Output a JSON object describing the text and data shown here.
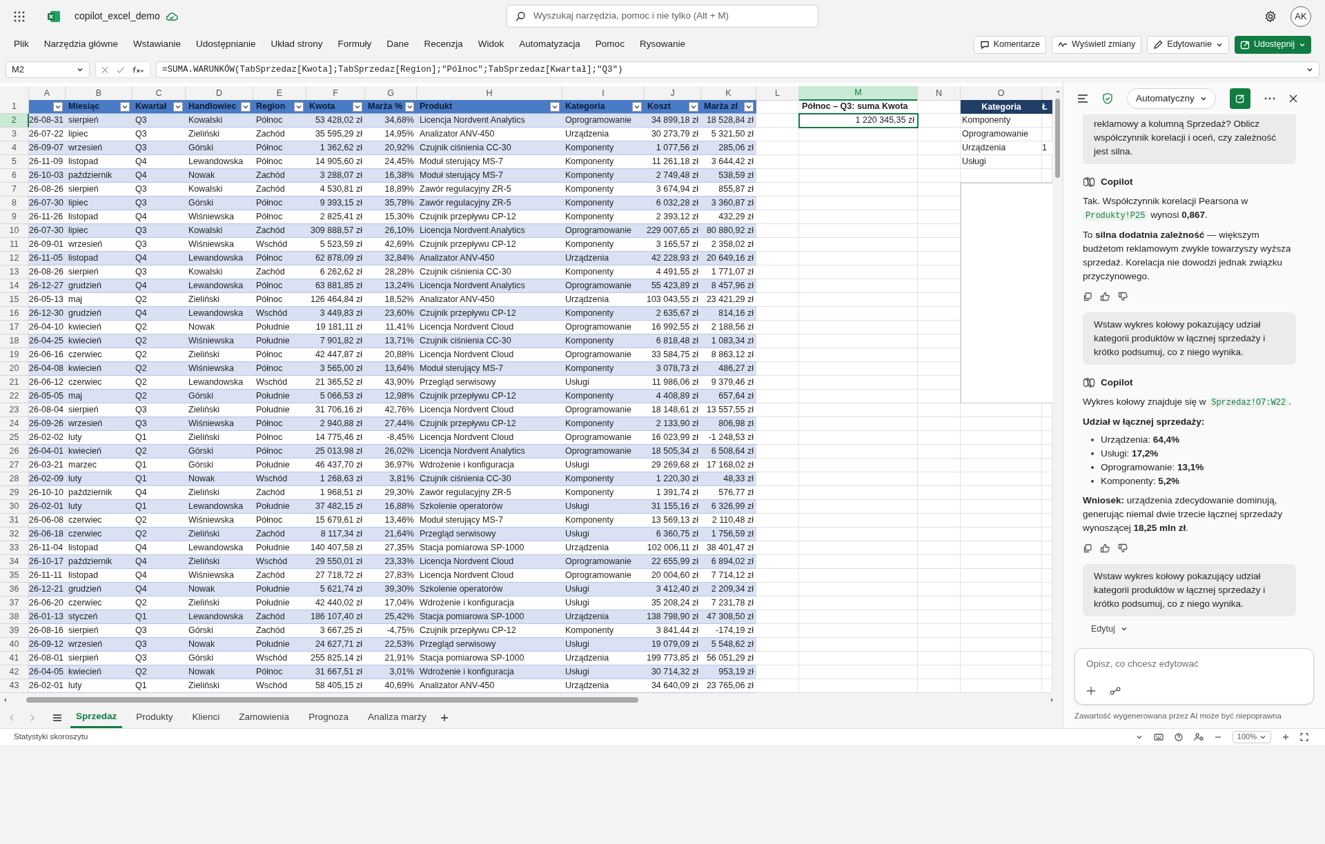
{
  "title_bar": {
    "file_name": "copilot_excel_demo",
    "search_placeholder": "Wyszukaj narzędzia, pomoc i nie tylko (Alt + M)",
    "avatar": "AK"
  },
  "menu": [
    "Plik",
    "Narzędzia główne",
    "Wstawianie",
    "Udostępnianie",
    "Układ strony",
    "Formuły",
    "Dane",
    "Recenzja",
    "Widok",
    "Automatyzacja",
    "Pomoc",
    "Rysowanie"
  ],
  "toolbar_buttons": [
    {
      "kind": "comments",
      "label": "Komentarze"
    },
    {
      "kind": "changes",
      "label": "Wyświetl zmiany"
    },
    {
      "kind": "editing",
      "label": "Edytowanie"
    },
    {
      "kind": "share",
      "label": "Udostępnij"
    }
  ],
  "formula_bar": {
    "name_box": "M2",
    "formula": "=SUMA.WARUNKÓW(TabSprzedaz[Kwota];TabSprzedaz[Region];\"Północ\";TabSprzedaz[Kwartał];\"Q3\")"
  },
  "columns": [
    {
      "letter": "A",
      "selected": false
    },
    {
      "letter": "B",
      "selected": false
    },
    {
      "letter": "C",
      "selected": false
    },
    {
      "letter": "D",
      "selected": false
    },
    {
      "letter": "E",
      "selected": false
    },
    {
      "letter": "F",
      "selected": false
    },
    {
      "letter": "G",
      "selected": false
    },
    {
      "letter": "H",
      "selected": false
    },
    {
      "letter": "I",
      "selected": false
    },
    {
      "letter": "J",
      "selected": false
    },
    {
      "letter": "K",
      "selected": false
    },
    {
      "letter": "L",
      "selected": false
    },
    {
      "letter": "M",
      "selected": true
    },
    {
      "letter": "N",
      "selected": false
    },
    {
      "letter": "O",
      "selected": false
    }
  ],
  "table": {
    "header_row_number": "1",
    "headers": [
      {
        "filter": true
      },
      {
        "label": "Miesiąc",
        "filter": true
      },
      {
        "label": "Kwartał",
        "filter": true
      },
      {
        "label": "Handlowiec",
        "filter": true
      },
      {
        "label": "Region",
        "filter": true
      },
      {
        "label": "Kwota",
        "filter": true
      },
      {
        "label": "Marża %",
        "filter": true
      },
      {
        "label": "Produkt",
        "filter": true
      },
      {
        "label": "Kategoria",
        "filter": true
      },
      {
        "label": "Koszt",
        "filter": true
      },
      {
        "label": "Marża zł",
        "filter": true
      }
    ],
    "rows": [
      {
        "number": "2",
        "selected": true,
        "cells": [
          "26-08-31",
          "sierpień",
          "Q3",
          "Kowalski",
          "Północ",
          "53 428,02 zł",
          "34,68%",
          "Licencja Nordvent Analytics",
          "Oprogramowanie",
          "34 899,18 zł",
          "18 528,84 zł"
        ]
      },
      {
        "number": "3",
        "selected": false,
        "cells": [
          "26-07-22",
          "lipiec",
          "Q3",
          "Zieliński",
          "Zachód",
          "35 595,29 zł",
          "14,95%",
          "Analizator ANV-450",
          "Urządzenia",
          "30 273,79 zł",
          "5 321,50 zł"
        ]
      },
      {
        "number": "4",
        "selected": false,
        "cells": [
          "26-09-07",
          "wrzesień",
          "Q3",
          "Górski",
          "Północ",
          "1 362,62 zł",
          "20,92%",
          "Czujnik ciśnienia CC-30",
          "Komponenty",
          "1 077,56 zł",
          "285,06 zł"
        ]
      },
      {
        "number": "5",
        "selected": false,
        "cells": [
          "26-11-09",
          "listopad",
          "Q4",
          "Lewandowska",
          "Północ",
          "14 905,60 zł",
          "24,45%",
          "Moduł sterujący MS-7",
          "Komponenty",
          "11 261,18 zł",
          "3 644,42 zł"
        ]
      },
      {
        "number": "6",
        "selected": false,
        "cells": [
          "26-10-03",
          "październik",
          "Q4",
          "Nowak",
          "Zachód",
          "3 288,07 zł",
          "16,38%",
          "Moduł sterujący MS-7",
          "Komponenty",
          "2 749,48 zł",
          "538,59 zł"
        ]
      },
      {
        "number": "7",
        "selected": false,
        "cells": [
          "26-08-26",
          "sierpień",
          "Q3",
          "Kowalski",
          "Zachód",
          "4 530,81 zł",
          "18,89%",
          "Zawór regulacyjny ZR-5",
          "Komponenty",
          "3 674,94 zł",
          "855,87 zł"
        ]
      },
      {
        "number": "8",
        "selected": false,
        "cells": [
          "26-07-30",
          "lipiec",
          "Q3",
          "Górski",
          "Północ",
          "9 393,15 zł",
          "35,78%",
          "Zawór regulacyjny ZR-5",
          "Komponenty",
          "6 032,28 zł",
          "3 360,87 zł"
        ]
      },
      {
        "number": "9",
        "selected": false,
        "cells": [
          "26-11-26",
          "listopad",
          "Q4",
          "Wiśniewska",
          "Północ",
          "2 825,41 zł",
          "15,30%",
          "Czujnik przepływu CP-12",
          "Komponenty",
          "2 393,12 zł",
          "432,29 zł"
        ]
      },
      {
        "number": "10",
        "selected": false,
        "cells": [
          "26-07-30",
          "lipiec",
          "Q3",
          "Kowalski",
          "Zachód",
          "309 888,57 zł",
          "26,10%",
          "Licencja Nordvent Analytics",
          "Oprogramowanie",
          "229 007,65 zł",
          "80 880,92 zł"
        ]
      },
      {
        "number": "11",
        "selected": false,
        "cells": [
          "26-09-01",
          "wrzesień",
          "Q3",
          "Wiśniewska",
          "Wschód",
          "5 523,59 zł",
          "42,69%",
          "Czujnik przepływu CP-12",
          "Komponenty",
          "3 165,57 zł",
          "2 358,02 zł"
        ]
      },
      {
        "number": "12",
        "selected": false,
        "cells": [
          "26-11-05",
          "listopad",
          "Q4",
          "Lewandowska",
          "Północ",
          "62 878,09 zł",
          "32,84%",
          "Analizator ANV-450",
          "Urządzenia",
          "42 228,93 zł",
          "20 649,16 zł"
        ]
      },
      {
        "number": "13",
        "selected": false,
        "cells": [
          "26-08-26",
          "sierpień",
          "Q3",
          "Kowalski",
          "Zachód",
          "6 262,62 zł",
          "28,28%",
          "Czujnik ciśnienia CC-30",
          "Komponenty",
          "4 491,55 zł",
          "1 771,07 zł"
        ]
      },
      {
        "number": "14",
        "selected": false,
        "cells": [
          "26-12-27",
          "grudzień",
          "Q4",
          "Lewandowska",
          "Północ",
          "63 881,85 zł",
          "13,24%",
          "Licencja Nordvent Analytics",
          "Oprogramowanie",
          "55 423,89 zł",
          "8 457,96 zł"
        ]
      },
      {
        "number": "15",
        "selected": false,
        "cells": [
          "26-05-13",
          "maj",
          "Q2",
          "Zieliński",
          "Północ",
          "126 464,84 zł",
          "18,52%",
          "Analizator ANV-450",
          "Urządzenia",
          "103 043,55 zł",
          "23 421,29 zł"
        ]
      },
      {
        "number": "16",
        "selected": false,
        "cells": [
          "26-12-30",
          "grudzień",
          "Q4",
          "Lewandowska",
          "Wschód",
          "3 449,83 zł",
          "23,60%",
          "Czujnik przepływu CP-12",
          "Komponenty",
          "2 635,67 zł",
          "814,16 zł"
        ]
      },
      {
        "number": "17",
        "selected": false,
        "cells": [
          "26-04-10",
          "kwiecień",
          "Q2",
          "Nowak",
          "Południe",
          "19 181,11 zł",
          "11,41%",
          "Licencja Nordvent Cloud",
          "Oprogramowanie",
          "16 992,55 zł",
          "2 188,56 zł"
        ]
      },
      {
        "number": "18",
        "selected": false,
        "cells": [
          "26-04-25",
          "kwiecień",
          "Q2",
          "Wiśniewska",
          "Południe",
          "7 901,82 zł",
          "13,71%",
          "Czujnik ciśnienia CC-30",
          "Komponenty",
          "6 818,48 zł",
          "1 083,34 zł"
        ]
      },
      {
        "number": "19",
        "selected": false,
        "cells": [
          "26-06-16",
          "czerwiec",
          "Q2",
          "Zieliński",
          "Północ",
          "42 447,87 zł",
          "20,88%",
          "Licencja Nordvent Cloud",
          "Oprogramowanie",
          "33 584,75 zł",
          "8 863,12 zł"
        ]
      },
      {
        "number": "20",
        "selected": false,
        "cells": [
          "26-04-08",
          "kwiecień",
          "Q2",
          "Wiśniewska",
          "Północ",
          "3 565,00 zł",
          "13,64%",
          "Moduł sterujący MS-7",
          "Komponenty",
          "3 078,73 zł",
          "486,27 zł"
        ]
      },
      {
        "number": "21",
        "selected": false,
        "cells": [
          "26-06-12",
          "czerwiec",
          "Q2",
          "Lewandowska",
          "Wschód",
          "21 365,52 zł",
          "43,90%",
          "Przegląd serwisowy",
          "Usługi",
          "11 986,06 zł",
          "9 379,46 zł"
        ]
      },
      {
        "number": "22",
        "selected": false,
        "cells": [
          "26-05-05",
          "maj",
          "Q2",
          "Górski",
          "Południe",
          "5 066,53 zł",
          "12,98%",
          "Czujnik przepływu CP-12",
          "Komponenty",
          "4 408,89 zł",
          "657,64 zł"
        ]
      },
      {
        "number": "23",
        "selected": false,
        "cells": [
          "26-08-04",
          "sierpień",
          "Q3",
          "Zieliński",
          "Południe",
          "31 706,16 zł",
          "42,76%",
          "Licencja Nordvent Cloud",
          "Oprogramowanie",
          "18 148,61 zł",
          "13 557,55 zł"
        ]
      },
      {
        "number": "24",
        "selected": false,
        "cells": [
          "26-09-26",
          "wrzesień",
          "Q3",
          "Wiśniewska",
          "Północ",
          "2 940,88 zł",
          "27,44%",
          "Czujnik przepływu CP-12",
          "Komponenty",
          "2 133,90 zł",
          "806,98 zł"
        ]
      },
      {
        "number": "25",
        "selected": false,
        "cells": [
          "26-02-02",
          "luty",
          "Q1",
          "Zieliński",
          "Północ",
          "14 775,46 zł",
          "-8,45%",
          "Licencja Nordvent Cloud",
          "Oprogramowanie",
          "16 023,99 zł",
          "-1 248,53 zł"
        ]
      },
      {
        "number": "26",
        "selected": false,
        "cells": [
          "26-04-01",
          "kwiecień",
          "Q2",
          "Górski",
          "Północ",
          "25 013,98 zł",
          "26,02%",
          "Licencja Nordvent Analytics",
          "Oprogramowanie",
          "18 505,34 zł",
          "6 508,64 zł"
        ]
      },
      {
        "number": "27",
        "selected": false,
        "cells": [
          "26-03-21",
          "marzec",
          "Q1",
          "Górski",
          "Południe",
          "46 437,70 zł",
          "36,97%",
          "Wdrożenie i konfiguracja",
          "Usługi",
          "29 269,68 zł",
          "17 168,02 zł"
        ]
      },
      {
        "number": "28",
        "selected": false,
        "cells": [
          "26-02-09",
          "luty",
          "Q1",
          "Nowak",
          "Wschód",
          "1 268,63 zł",
          "3,81%",
          "Czujnik ciśnienia CC-30",
          "Komponenty",
          "1 220,30 zł",
          "48,33 zł"
        ]
      },
      {
        "number": "29",
        "selected": false,
        "cells": [
          "26-10-10",
          "październik",
          "Q4",
          "Zieliński",
          "Zachód",
          "1 968,51 zł",
          "29,30%",
          "Zawór regulacyjny ZR-5",
          "Komponenty",
          "1 391,74 zł",
          "576,77 zł"
        ]
      },
      {
        "number": "30",
        "selected": false,
        "cells": [
          "26-02-01",
          "luty",
          "Q1",
          "Lewandowska",
          "Południe",
          "37 482,15 zł",
          "16,88%",
          "Szkolenie operatorów",
          "Usługi",
          "31 155,16 zł",
          "6 326,99 zł"
        ]
      },
      {
        "number": "31",
        "selected": false,
        "cells": [
          "26-06-08",
          "czerwiec",
          "Q2",
          "Wiśniewska",
          "Północ",
          "15 679,61 zł",
          "13,46%",
          "Moduł sterujący MS-7",
          "Komponenty",
          "13 569,13 zł",
          "2 110,48 zł"
        ]
      },
      {
        "number": "32",
        "selected": false,
        "cells": [
          "26-06-18",
          "czerwiec",
          "Q2",
          "Zieliński",
          "Zachód",
          "8 117,34 zł",
          "21,64%",
          "Przegląd serwisowy",
          "Usługi",
          "6 360,75 zł",
          "1 756,59 zł"
        ]
      },
      {
        "number": "33",
        "selected": false,
        "cells": [
          "26-11-04",
          "listopad",
          "Q4",
          "Lewandowska",
          "Południe",
          "140 407,58 zł",
          "27,35%",
          "Stacja pomiarowa SP-1000",
          "Urządzenia",
          "102 006,11 zł",
          "38 401,47 zł"
        ]
      },
      {
        "number": "34",
        "selected": false,
        "cells": [
          "26-10-17",
          "październik",
          "Q4",
          "Zieliński",
          "Wschód",
          "29 550,01 zł",
          "23,33%",
          "Licencja Nordvent Cloud",
          "Oprogramowanie",
          "22 655,99 zł",
          "6 894,02 zł"
        ]
      },
      {
        "number": "35",
        "selected": false,
        "cells": [
          "26-11-11",
          "listopad",
          "Q4",
          "Wiśniewska",
          "Zachód",
          "27 718,72 zł",
          "27,83%",
          "Licencja Nordvent Cloud",
          "Oprogramowanie",
          "20 004,60 zł",
          "7 714,12 zł"
        ]
      },
      {
        "number": "36",
        "selected": false,
        "cells": [
          "26-12-21",
          "grudzień",
          "Q4",
          "Nowak",
          "Południe",
          "5 621,74 zł",
          "39,30%",
          "Szkolenie operatorów",
          "Usługi",
          "3 412,40 zł",
          "2 209,34 zł"
        ]
      },
      {
        "number": "37",
        "selected": false,
        "cells": [
          "26-06-20",
          "czerwiec",
          "Q2",
          "Zieliński",
          "Południe",
          "42 440,02 zł",
          "17,04%",
          "Wdrożenie i konfiguracja",
          "Usługi",
          "35 208,24 zł",
          "7 231,78 zł"
        ]
      },
      {
        "number": "38",
        "selected": false,
        "cells": [
          "26-01-13",
          "styczeń",
          "Q1",
          "Lewandowska",
          "Zachód",
          "186 107,40 zł",
          "25,42%",
          "Stacja pomiarowa SP-1000",
          "Urządzenia",
          "138 798,90 zł",
          "47 308,50 zł"
        ]
      },
      {
        "number": "39",
        "selected": false,
        "cells": [
          "26-08-16",
          "sierpień",
          "Q3",
          "Górski",
          "Zachód",
          "3 667,25 zł",
          "-4,75%",
          "Czujnik przepływu CP-12",
          "Komponenty",
          "3 841,44 zł",
          "-174,19 zł"
        ]
      },
      {
        "number": "40",
        "selected": false,
        "cells": [
          "26-09-12",
          "wrzesień",
          "Q3",
          "Nowak",
          "Południe",
          "24 627,71 zł",
          "22,53%",
          "Przegląd serwisowy",
          "Usługi",
          "19 079,09 zł",
          "5 548,62 zł"
        ]
      },
      {
        "number": "41",
        "selected": false,
        "cells": [
          "26-08-01",
          "sierpień",
          "Q3",
          "Górski",
          "Wschód",
          "255 825,14 zł",
          "21,91%",
          "Stacja pomiarowa SP-1000",
          "Urządzenia",
          "199 773,85 zł",
          "56 051,29 zł"
        ]
      },
      {
        "number": "42",
        "selected": false,
        "cells": [
          "26-04-05",
          "kwiecień",
          "Q2",
          "Nowak",
          "Północ",
          "31 667,51 zł",
          "3,01%",
          "Wdrożenie i konfiguracja",
          "Usługi",
          "30 714,32 zł",
          "953,19 zł"
        ]
      },
      {
        "number": "43",
        "selected": false,
        "cells": [
          "26-02-01",
          "luty",
          "Q1",
          "Zieliński",
          "Wschód",
          "58 405,15 zł",
          "40,69%",
          "Analizator ANV-450",
          "Urządzenia",
          "34 640,09 zł",
          "23 765,06 zł"
        ]
      }
    ]
  },
  "summary": {
    "label": "Północ – Q3: suma Kwota",
    "value": "1 220 345,35 zł"
  },
  "category_table": {
    "header": "Kategoria",
    "header_cut": "Ł",
    "items": [
      {
        "label": "Komponenty"
      },
      {
        "label": "Oprogramowanie"
      },
      {
        "label": "Urządzenia",
        "column_p": "1"
      },
      {
        "label": "Usługi"
      }
    ]
  },
  "sheet_tabs": [
    {
      "label": "Sprzedaz",
      "selected": true
    },
    {
      "label": "Produkty",
      "selected": false
    },
    {
      "label": "Klienci",
      "selected": false
    },
    {
      "label": "Zamowienia",
      "selected": false
    },
    {
      "label": "Prognoza",
      "selected": false
    },
    {
      "label": "Analiza marży",
      "selected": false
    }
  ],
  "status_bar": {
    "text": "Statystyki skoroszytu",
    "zoom": "100%"
  },
  "copilot": {
    "mode": "Automatyczny",
    "messages": [
      {
        "kind": "user",
        "text": "reklamowy a kolumną Sprzedaż? Oblicz współczynnik korelacji i oceń, czy zależność jest silna."
      },
      {
        "kind": "assistant",
        "author": "Copilot",
        "blocks": [
          {
            "kind": "paragraph",
            "parts": [
              {
                "kind": "text",
                "text": "Tak. Współczynnik korelacji Pearsona w"
              },
              {
                "kind": "code",
                "text": "Produkty!P25"
              },
              {
                "kind": "text",
                "text": "wynosi **0,867**."
              }
            ]
          },
          {
            "kind": "paragraph",
            "parts": [
              {
                "kind": "text",
                "text": "To **silna dodatnia zależność** — większym budżetom reklamowym zwykle towarzyszy wyższa sprzedaż. Korelacja nie dowodzi jednak związku przyczynowego."
              }
            ]
          }
        ]
      },
      {
        "kind": "user",
        "text": "Wstaw wykres kołowy pokazujący udział kategorii produktów w łącznej sprzedaży i krótko podsumuj, co z niego wynika."
      },
      {
        "kind": "assistant",
        "author": "Copilot",
        "blocks": [
          {
            "kind": "paragraph",
            "parts": [
              {
                "kind": "text",
                "text": "Wykres kołowy znajduje się w"
              },
              {
                "kind": "code",
                "text": "Sprzedaz!O7:W22"
              },
              {
                "kind": "text",
                "text": "."
              }
            ]
          },
          {
            "kind": "heading",
            "text": "Udział w łącznej sprzedaży:"
          },
          {
            "kind": "bullets",
            "items": [
              "Urządzenia: **64,4%**",
              "Usługi: **17,2%**",
              "Oprogramowanie: **13,1%**",
              "Komponenty: **5,2%**"
            ]
          },
          {
            "kind": "paragraph",
            "parts": [
              {
                "kind": "text",
                "text": "**Wniosek:** urządzenia zdecydowanie dominują, generując niemal dwie trzecie łącznej sprzedaży wynoszącej **18,25 mln zł**."
              }
            ]
          }
        ]
      },
      {
        "kind": "user",
        "text": "Wstaw wykres kołowy pokazujący udział kategorii produktów w łącznej sprzedaży i krótko podsumuj, co z niego wynika."
      }
    ],
    "edit_label": "Edytuj",
    "input_placeholder": "Opisz, co chcesz edytować",
    "disclaimer": "Zawartość wygenerowana przez AI może być niepoprawna"
  }
}
